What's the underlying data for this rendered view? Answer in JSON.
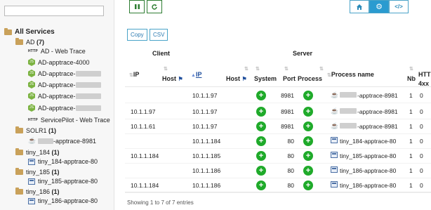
{
  "sidebar": {
    "search_value": "",
    "root_label": "All Services",
    "groups": [
      {
        "label": "AD",
        "count": "(7)"
      },
      {
        "label": "SOLR1",
        "count": "(1)"
      },
      {
        "label": "tiny_184",
        "count": "(1)"
      },
      {
        "label": "tiny_185",
        "count": "(1)"
      },
      {
        "label": "tiny_186",
        "count": "(1)"
      }
    ],
    "ad_items": [
      "AD - Web Trace",
      "AD-apptrace-4000",
      "AD-apptrace-",
      "AD-apptrace-",
      "AD-apptrace-",
      "AD-apptrace-",
      "ServicePilot - Web Trace"
    ],
    "solr_item": "-apptrace-8981",
    "tiny184_item": "tiny_184-apptrace-80",
    "tiny185_item": "tiny_185-apptrace-80",
    "tiny186_item": "tiny_186-apptrace-80"
  },
  "toolbar": {
    "copy": "Copy",
    "csv": "CSV"
  },
  "icons": {
    "pause": "pause-icon",
    "refresh": "refresh-icon",
    "home": "home-icon",
    "gear": "gear-icon",
    "code": "code-icon"
  },
  "table": {
    "group_client": "Client",
    "group_server": "Server",
    "col_ip": "IP",
    "col_host": "Host",
    "col_server_ip": "IP",
    "col_server_host": "Host",
    "col_system": "System",
    "col_port": "Port",
    "col_process": "Process",
    "col_process_name": "Process name",
    "col_nb": "Nb",
    "col_http": "HTTP",
    "col_4xx": "4xx",
    "rows": [
      {
        "client_ip": "",
        "server_ip": "10.1.1.97",
        "port": "8981",
        "pname": "-apptrace-8981",
        "nb": "1",
        "h4": "0"
      },
      {
        "client_ip": "10.1.1.97",
        "server_ip": "10.1.1.97",
        "port": "8981",
        "pname": "-apptrace-8981",
        "nb": "1",
        "h4": "0"
      },
      {
        "client_ip": "10.1.1.61",
        "server_ip": "10.1.1.97",
        "port": "8981",
        "pname": "-apptrace-8981",
        "nb": "1",
        "h4": "0"
      },
      {
        "client_ip": "",
        "server_ip": "10.1.1.184",
        "port": "80",
        "pname": "tiny_184-apptrace-80",
        "nb": "1",
        "h4": "0"
      },
      {
        "client_ip": "10.1.1.184",
        "server_ip": "10.1.1.185",
        "port": "80",
        "pname": "tiny_185-apptrace-80",
        "nb": "1",
        "h4": "0"
      },
      {
        "client_ip": "",
        "server_ip": "10.1.1.186",
        "port": "80",
        "pname": "tiny_186-apptrace-80",
        "nb": "1",
        "h4": "0"
      },
      {
        "client_ip": "10.1.1.184",
        "server_ip": "10.1.1.186",
        "port": "80",
        "pname": "tiny_186-apptrace-80",
        "nb": "1",
        "h4": "0"
      }
    ]
  },
  "footer": "Showing 1 to 7 of 7 entries"
}
